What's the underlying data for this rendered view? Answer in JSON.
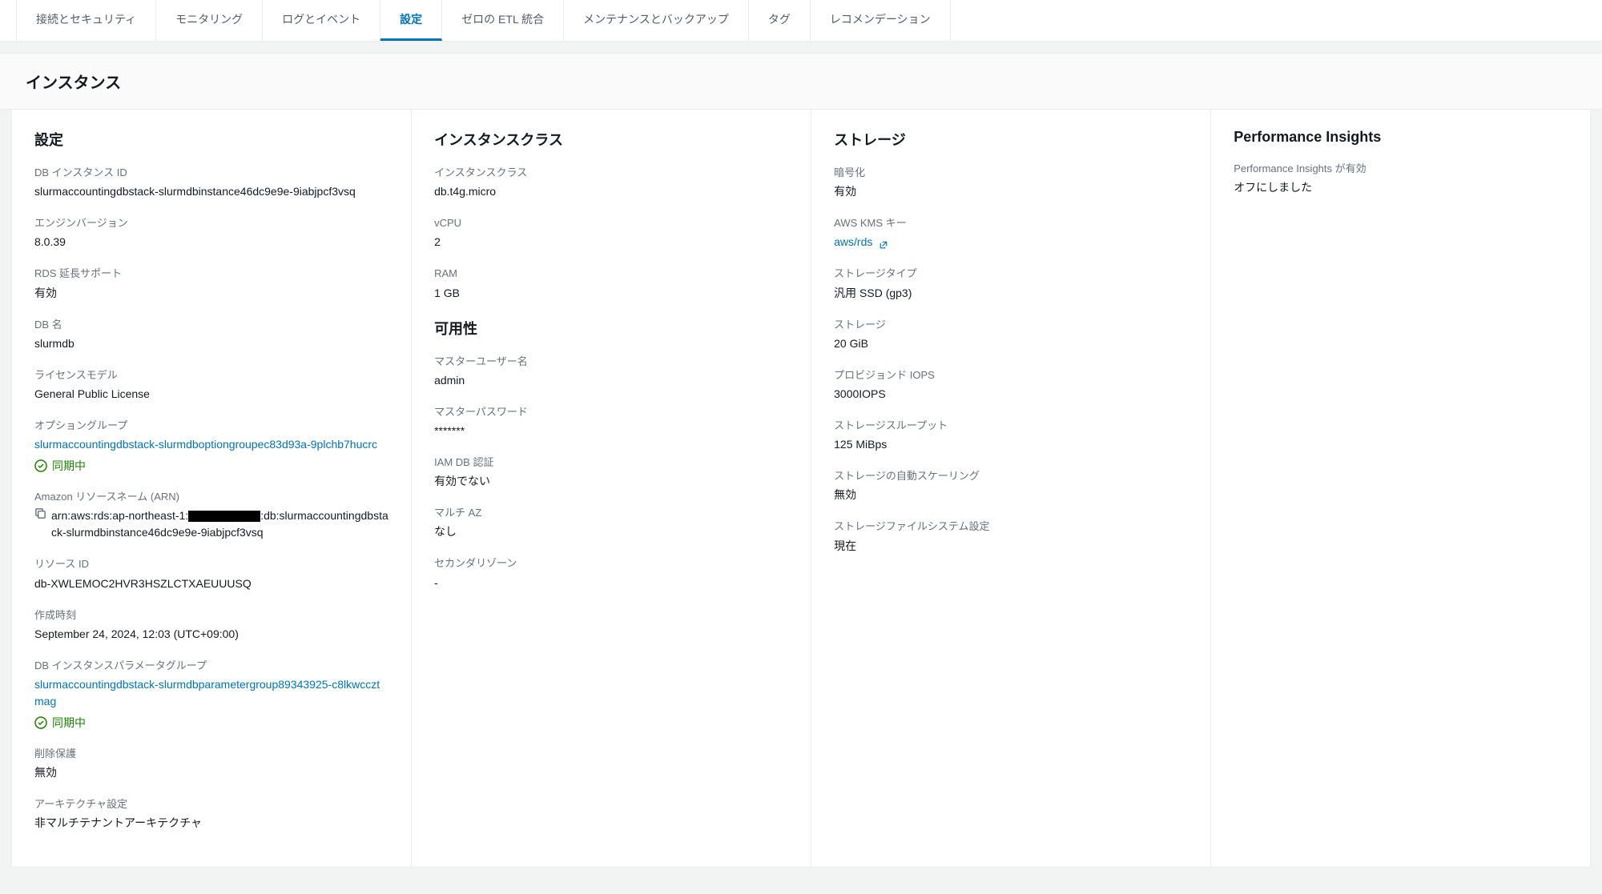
{
  "tabs": [
    {
      "label": "接続とセキュリティ",
      "active": false
    },
    {
      "label": "モニタリング",
      "active": false
    },
    {
      "label": "ログとイベント",
      "active": false
    },
    {
      "label": "設定",
      "active": true
    },
    {
      "label": "ゼロの ETL 統合",
      "active": false
    },
    {
      "label": "メンテナンスとバックアップ",
      "active": false
    },
    {
      "label": "タグ",
      "active": false
    },
    {
      "label": "レコメンデーション",
      "active": false
    }
  ],
  "section_title": "インスタンス",
  "columns": {
    "settings": {
      "heading": "設定",
      "db_instance_id": {
        "label": "DB インスタンス ID",
        "value": "slurmaccountingdbstack-slurmdbinstance46dc9e9e-9iabjpcf3vsq"
      },
      "engine_version": {
        "label": "エンジンバージョン",
        "value": "8.0.39"
      },
      "rds_extended_support": {
        "label": "RDS 延長サポート",
        "value": "有効"
      },
      "db_name": {
        "label": "DB 名",
        "value": "slurmdb"
      },
      "license_model": {
        "label": "ライセンスモデル",
        "value": "General Public License"
      },
      "option_group": {
        "label": "オプショングループ",
        "link": "slurmaccountingdbstack-slurmdboptiongroupec83d93a-9plchb7hucrc",
        "status": "同期中"
      },
      "arn": {
        "label": "Amazon リソースネーム (ARN)",
        "prefix": "arn:aws:rds:ap-northeast-1:",
        "suffix": ":db:slurmaccountingdbstack-slurmdbinstance46dc9e9e-9iabjpcf3vsq"
      },
      "resource_id": {
        "label": "リソース ID",
        "value": "db-XWLEMOC2HVR3HSZLCTXAEUUUSQ"
      },
      "created_at": {
        "label": "作成時刻",
        "value": "September 24, 2024, 12:03 (UTC+09:00)"
      },
      "parameter_group": {
        "label": "DB インスタンスパラメータグループ",
        "link": "slurmaccountingdbstack-slurmdbparametergroup89343925-c8lkwccztmag",
        "status": "同期中"
      },
      "deletion_protection": {
        "label": "削除保護",
        "value": "無効"
      },
      "architecture": {
        "label": "アーキテクチャ設定",
        "value": "非マルチテナントアーキテクチャ"
      }
    },
    "instance_class": {
      "heading": "インスタンスクラス",
      "class": {
        "label": "インスタンスクラス",
        "value": "db.t4g.micro"
      },
      "vcpu": {
        "label": "vCPU",
        "value": "2"
      },
      "ram": {
        "label": "RAM",
        "value": "1 GB"
      },
      "availability_heading": "可用性",
      "master_user": {
        "label": "マスターユーザー名",
        "value": "admin"
      },
      "master_password": {
        "label": "マスターパスワード",
        "value": "*******"
      },
      "iam_db_auth": {
        "label": "IAM DB 認証",
        "value": "有効でない"
      },
      "multi_az": {
        "label": "マルチ AZ",
        "value": "なし"
      },
      "secondary_zone": {
        "label": "セカンダリゾーン",
        "value": "-"
      }
    },
    "storage": {
      "heading": "ストレージ",
      "encryption": {
        "label": "暗号化",
        "value": "有効"
      },
      "kms_key": {
        "label": "AWS KMS キー",
        "link": "aws/rds"
      },
      "storage_type": {
        "label": "ストレージタイプ",
        "value": "汎用 SSD (gp3)"
      },
      "storage": {
        "label": "ストレージ",
        "value": "20 GiB"
      },
      "provisioned_iops": {
        "label": "プロビジョンド IOPS",
        "value": "3000IOPS"
      },
      "throughput": {
        "label": "ストレージスループット",
        "value": "125 MiBps"
      },
      "autoscaling": {
        "label": "ストレージの自動スケーリング",
        "value": "無効"
      },
      "filesystem": {
        "label": "ストレージファイルシステム設定",
        "value": "現在"
      }
    },
    "performance_insights": {
      "heading": "Performance Insights",
      "enabled": {
        "label": "Performance Insights が有効",
        "value": "オフにしました"
      }
    }
  }
}
